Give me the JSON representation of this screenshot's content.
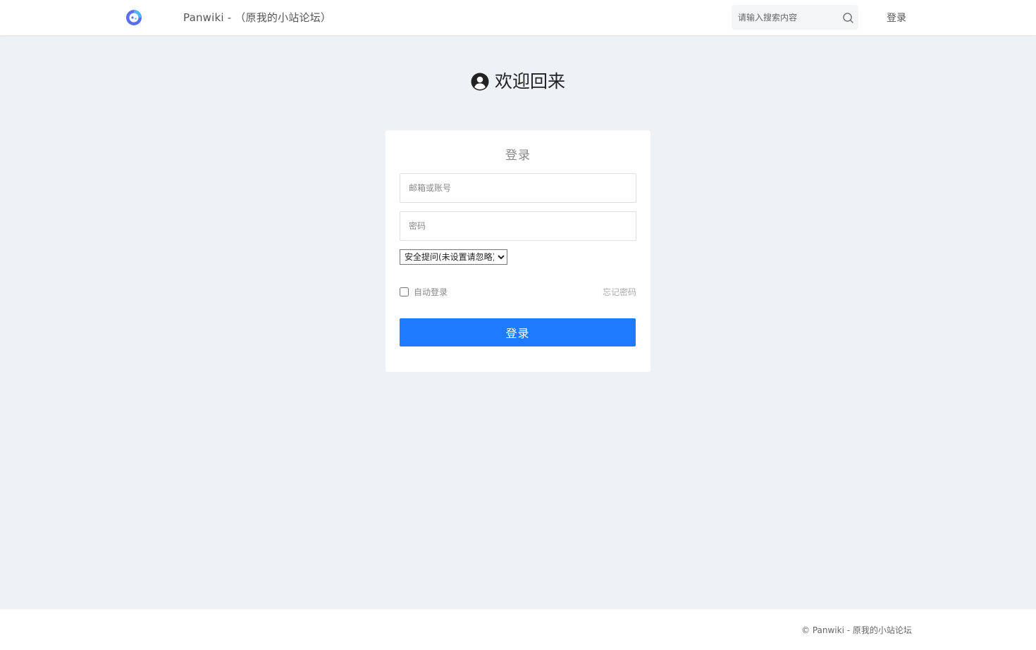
{
  "header": {
    "site_title": "Panwiki - （原我的小站论坛）",
    "search_placeholder": "请输入搜索内容",
    "login_link": "登录",
    "logo_icon": "panwiki-logo-icon",
    "search_icon": "search-icon"
  },
  "welcome": {
    "icon": "user-circle-icon",
    "text": "欢迎回来"
  },
  "login_form": {
    "title": "登录",
    "email_placeholder": "邮箱或账号",
    "password_placeholder": "密码",
    "security_question_selected": "安全提问(未设置请忽略)",
    "remember_label": "自动登录",
    "remember_checked": false,
    "forgot_link": "忘记密码",
    "submit_label": "登录",
    "accent_color": "#1e7bff"
  },
  "footer": {
    "copyright": "© Panwiki - 原我的小站论坛"
  }
}
